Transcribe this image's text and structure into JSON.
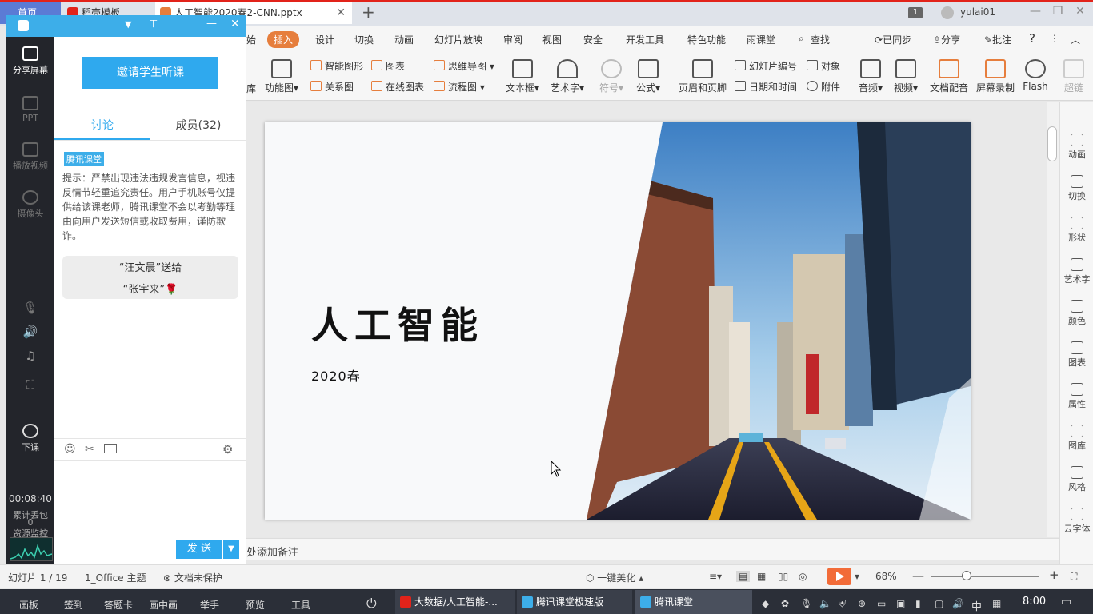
{
  "tabs": {
    "home": "首页",
    "templates": "稻壳模板",
    "document": "人工智能2020春2-CNN.pptx",
    "badge": "1",
    "user": "yulai01"
  },
  "ribbon_tabs": [
    "始",
    "插入",
    "设计",
    "切换",
    "动画",
    "幻灯片放映",
    "审阅",
    "视图",
    "安全",
    "开发工具",
    "特色功能",
    "雨课堂",
    "查找"
  ],
  "ribbon_right": {
    "sync": "已同步",
    "share": "分享",
    "comment": "批注",
    "help": "?"
  },
  "ribbon": {
    "lib": "库",
    "funcgraph": "功能图",
    "smartart": "智能图形",
    "chart": "图表",
    "mindmap": "思维导图",
    "relation": "关系图",
    "onlinechart": "在线图表",
    "flowchart": "流程图",
    "textbox": "文本框",
    "wordart": "艺术字",
    "symbol": "符号",
    "formula": "公式",
    "headerfooter": "页眉和页脚",
    "slidenum": "幻灯片编号",
    "object": "对象",
    "datetime": "日期和时间",
    "attach": "附件",
    "audio": "音频",
    "video": "视频",
    "voiceover": "文档配音",
    "screenrec": "屏幕录制",
    "flash": "Flash",
    "hyperlink": "超链"
  },
  "slide": {
    "title": "人工智能",
    "subtitle": "2020春"
  },
  "right_panel": [
    "动画",
    "切换",
    "形状",
    "艺术字",
    "颜色",
    "图表",
    "属性",
    "图库",
    "风格",
    "云字体"
  ],
  "notes": "处添加备注",
  "status": {
    "slide": "幻灯片 1 / 19",
    "theme": "1_Office 主题",
    "protect": "文档未保护",
    "beautify": "一键美化",
    "zoom": "68%"
  },
  "taskbar": {
    "items": [
      "画板",
      "签到",
      "答题卡",
      "画中画",
      "举手",
      "预览",
      "工具"
    ],
    "tasks": [
      "大数据/人工智能-...",
      "腾讯课堂极速版",
      "腾讯课堂"
    ],
    "ime": "中",
    "clock": "8:00"
  },
  "classroom": {
    "share": "分享屏幕",
    "ppt": "PPT",
    "playvideo": "播放视频",
    "camera": "摄像头",
    "endclass": "下课",
    "timer": "00:08:40",
    "packet_loss": "累计丢包",
    "packet_loss_value": "0",
    "resource_monitor": "资源监控",
    "invite": "邀请学生听课",
    "tab_discuss": "讨论",
    "tab_members": "成员(32)",
    "tag": "腾讯课堂",
    "notice": "提示：严禁出现违法违规发言信息，视违反情节轻重追究责任。用户手机账号仅提供给该课老师，腾讯课堂不会以考勤等理由向用户发送短信或收取费用，谨防欺诈。",
    "gift_line1": "“汪文晨”送给",
    "gift_line2": "“张宇来”🌹",
    "send": "发 送"
  },
  "colors": {
    "accent_orange": "#e67e3d",
    "classroom_blue": "#2fa9ee",
    "title_bar_red": "#e2231a"
  }
}
